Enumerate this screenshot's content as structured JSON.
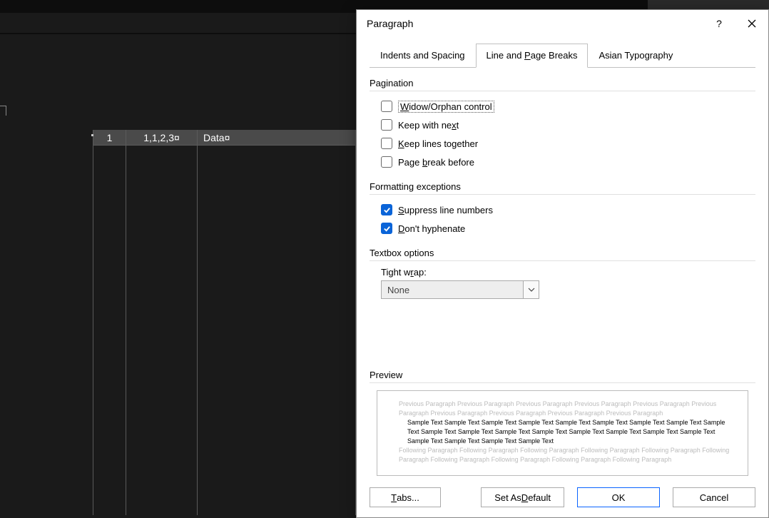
{
  "editor": {
    "table": {
      "col0_header": "1",
      "col1_header": "1,1,2,3¤",
      "col2_header": "Data¤"
    }
  },
  "dialog": {
    "title": "Paragraph",
    "help_symbol": "?",
    "tabs": {
      "indents": "Indents and Spacing",
      "line_breaks_pre": "Line and ",
      "line_breaks_mn": "P",
      "line_breaks_post": "age Breaks",
      "asian": "Asian Typography"
    },
    "sections": {
      "pagination": "Pagination",
      "formatting": "Formatting exceptions",
      "textbox": "Textbox options",
      "preview": "Preview"
    },
    "pagination": {
      "widow_pre": "",
      "widow_mn": "W",
      "widow_post": "idow/Orphan control",
      "keepnext_pre": "Keep with ne",
      "keepnext_mn": "x",
      "keepnext_post": "t",
      "keeplines_pre": "",
      "keeplines_mn": "K",
      "keeplines_post": "eep lines together",
      "pagebreak_pre": "Page ",
      "pagebreak_mn": "b",
      "pagebreak_post": "reak before"
    },
    "formatting_ex": {
      "suppress_pre": "",
      "suppress_mn": "S",
      "suppress_post": "uppress line numbers",
      "hyphen_pre": "",
      "hyphen_mn": "D",
      "hyphen_post": "on't hyphenate"
    },
    "textbox_opts": {
      "tightwrap_label_pre": "Tight w",
      "tightwrap_label_mn": "r",
      "tightwrap_label_post": "ap:",
      "tightwrap_value": "None"
    },
    "preview": {
      "prev_para": "Previous Paragraph Previous Paragraph Previous Paragraph Previous Paragraph Previous Paragraph Previous Paragraph Previous Paragraph Previous Paragraph Previous Paragraph Previous Paragraph",
      "sample": "Sample Text Sample Text Sample Text Sample Text Sample Text Sample Text Sample Text Sample Text Sample Text Sample Text Sample Text Sample Text Sample Text Sample Text Sample Text Sample Text Sample Text Sample Text Sample Text Sample Text Sample Text",
      "follow_para": "Following Paragraph Following Paragraph Following Paragraph Following Paragraph Following Paragraph Following Paragraph Following Paragraph Following Paragraph Following Paragraph Following Paragraph"
    },
    "buttons": {
      "tabs_pre": "",
      "tabs_mn": "T",
      "tabs_post": "abs...",
      "set_default_pre": "Set As ",
      "set_default_mn": "D",
      "set_default_post": "efault",
      "ok": "OK",
      "cancel": "Cancel"
    }
  }
}
